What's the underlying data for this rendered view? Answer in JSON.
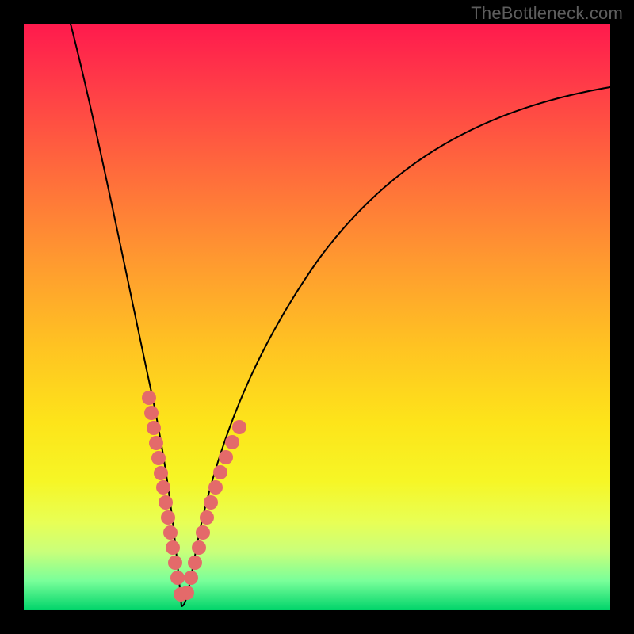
{
  "attribution": "TheBottleneck.com",
  "colors": {
    "frame": "#000000",
    "gradient_top": "#ff1a4d",
    "gradient_bottom": "#00d46a",
    "curve": "#000000",
    "bead": "#e46a6a"
  },
  "chart_data": {
    "type": "line",
    "title": "",
    "xlabel": "",
    "ylabel": "",
    "xlim": [
      0,
      100
    ],
    "ylim": [
      0,
      100
    ],
    "grid": false,
    "legend": false,
    "series": [
      {
        "name": "bottleneck-curve",
        "comment": "Estimated percentage-bottleneck vs relative component score; min at ~27 on x",
        "x": [
          8,
          10,
          12,
          14,
          16,
          18,
          20,
          22,
          24,
          26,
          27,
          28,
          30,
          32,
          34,
          37,
          40,
          45,
          50,
          55,
          60,
          65,
          70,
          75,
          80,
          85,
          90,
          95,
          100
        ],
        "values": [
          100,
          92,
          84,
          75,
          66,
          56,
          46,
          35,
          23,
          10,
          0,
          5,
          15,
          23,
          30,
          38,
          44,
          52,
          59,
          64,
          69,
          73,
          76,
          79,
          82,
          84,
          86,
          88,
          89
        ]
      }
    ],
    "markers": {
      "comment": "Pink bead clusters along the curve near the trough (left and right arms)",
      "points": [
        {
          "x": 20.0,
          "y": 46
        },
        {
          "x": 20.7,
          "y": 42
        },
        {
          "x": 21.4,
          "y": 38
        },
        {
          "x": 22.1,
          "y": 34
        },
        {
          "x": 22.8,
          "y": 30
        },
        {
          "x": 23.5,
          "y": 26
        },
        {
          "x": 24.0,
          "y": 23
        },
        {
          "x": 24.5,
          "y": 20
        },
        {
          "x": 25.0,
          "y": 17
        },
        {
          "x": 25.4,
          "y": 14
        },
        {
          "x": 25.8,
          "y": 11
        },
        {
          "x": 26.2,
          "y": 8
        },
        {
          "x": 26.5,
          "y": 5
        },
        {
          "x": 27.0,
          "y": 1
        },
        {
          "x": 27.6,
          "y": 2
        },
        {
          "x": 28.2,
          "y": 5
        },
        {
          "x": 28.8,
          "y": 8
        },
        {
          "x": 29.3,
          "y": 11
        },
        {
          "x": 29.9,
          "y": 14
        },
        {
          "x": 30.5,
          "y": 17
        },
        {
          "x": 31.1,
          "y": 20
        },
        {
          "x": 31.7,
          "y": 23
        },
        {
          "x": 32.4,
          "y": 26
        },
        {
          "x": 33.2,
          "y": 29
        },
        {
          "x": 34.1,
          "y": 32
        },
        {
          "x": 35.2,
          "y": 35
        }
      ]
    }
  }
}
